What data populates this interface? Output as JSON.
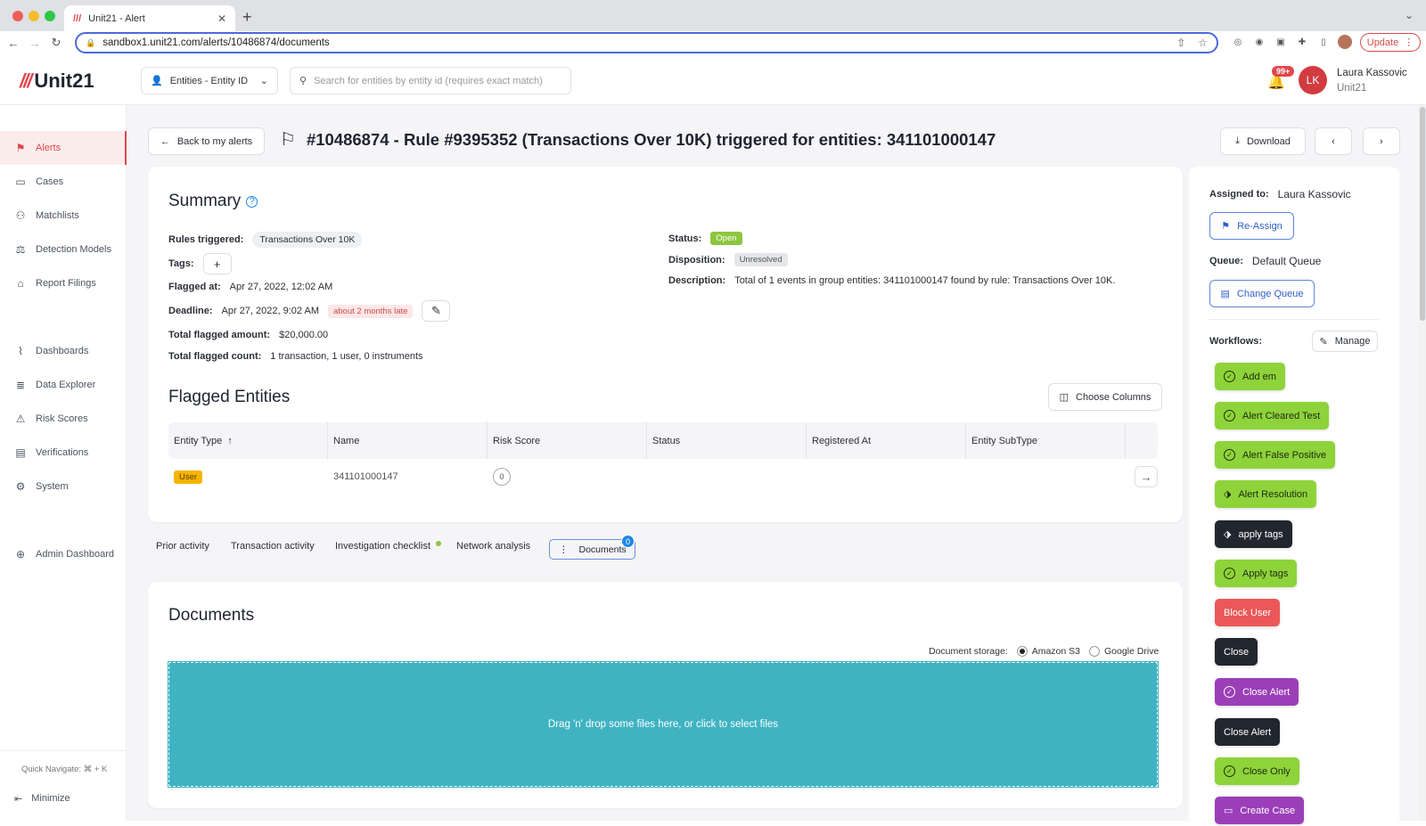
{
  "browser": {
    "tab_title": "Unit21 - Alert",
    "url": "sandbox1.unit21.com/alerts/10486874/documents",
    "update_label": "Update"
  },
  "header": {
    "logo_text": "Unit21",
    "entity_select": "Entities - Entity ID",
    "search_placeholder": "Search for entities by entity id (requires exact match)",
    "notif_count": "99+",
    "avatar_initials": "LK",
    "user_name": "Laura Kassovic",
    "user_org": "Unit21"
  },
  "sidebar": {
    "items": [
      {
        "label": "Alerts",
        "icon": "flag-icon"
      },
      {
        "label": "Cases",
        "icon": "briefcase-icon"
      },
      {
        "label": "Matchlists",
        "icon": "person-x-icon"
      },
      {
        "label": "Detection Models",
        "icon": "scale-icon"
      },
      {
        "label": "Report Filings",
        "icon": "bank-icon"
      },
      {
        "label": "Dashboards",
        "icon": "chart-icon"
      },
      {
        "label": "Data Explorer",
        "icon": "search-list-icon"
      },
      {
        "label": "Risk Scores",
        "icon": "warning-icon"
      },
      {
        "label": "Verifications",
        "icon": "id-card-icon"
      },
      {
        "label": "System",
        "icon": "gear-icon"
      },
      {
        "label": "Admin Dashboard",
        "icon": "globe-icon"
      }
    ],
    "quick_navigate": "Quick Navigate: ⌘ + K",
    "minimize": "Minimize"
  },
  "page": {
    "back_label": "Back to my alerts",
    "title": "#10486874 - Rule #9395352 (Transactions Over 10K) triggered for entities: 341101000147",
    "download_label": "Download"
  },
  "summary": {
    "heading": "Summary",
    "rules_triggered_label": "Rules triggered:",
    "rules_triggered_value": "Transactions Over 10K",
    "tags_label": "Tags:",
    "flagged_at_label": "Flagged at:",
    "flagged_at_value": "Apr 27, 2022, 12:02 AM",
    "deadline_label": "Deadline:",
    "deadline_value": "Apr 27, 2022, 9:02 AM",
    "deadline_badge": "about 2 months late",
    "amount_label": "Total flagged amount:",
    "amount_value": "$20,000.00",
    "count_label": "Total flagged count:",
    "count_value": "1 transaction, 1 user, 0 instruments",
    "status_label": "Status:",
    "status_value": "Open",
    "disposition_label": "Disposition:",
    "disposition_value": "Unresolved",
    "description_label": "Description:",
    "description_value": "Total of 1 events in group entities: 341101000147 found by rule: Transactions Over 10K."
  },
  "flagged": {
    "heading": "Flagged Entities",
    "choose_columns": "Choose Columns",
    "columns": [
      "Entity Type",
      "Name",
      "Risk Score",
      "Status",
      "Registered At",
      "Entity SubType"
    ],
    "rows": [
      {
        "type": "User",
        "name": "341101000147",
        "risk": "0",
        "status": "",
        "registered": "",
        "subtype": ""
      }
    ]
  },
  "tabs": {
    "items": [
      "Prior activity",
      "Transaction activity",
      "Investigation checklist",
      "Network analysis"
    ],
    "documents": "Documents",
    "documents_count": "0"
  },
  "documents": {
    "heading": "Documents",
    "storage_label": "Document storage:",
    "storage_options": [
      "Amazon S3",
      "Google Drive"
    ],
    "storage_selected": "Amazon S3",
    "drop_text": "Drag 'n' drop some files here, or click to select files"
  },
  "side": {
    "assigned_label": "Assigned to:",
    "assigned_value": "Laura Kassovic",
    "reassign": "Re-Assign",
    "queue_label": "Queue:",
    "queue_value": "Default Queue",
    "change_queue": "Change Queue",
    "workflows_label": "Workflows:",
    "manage": "Manage",
    "workflows": [
      {
        "label": "Add em",
        "style": "green",
        "icon": "check-circle-icon"
      },
      {
        "label": "Alert Cleared Test",
        "style": "green",
        "icon": "check-circle-icon"
      },
      {
        "label": "Alert False Positive",
        "style": "green",
        "icon": "check-circle-icon"
      },
      {
        "label": "Alert Resolution",
        "style": "green",
        "icon": "tag-icon"
      },
      {
        "label": "apply tags",
        "style": "dark",
        "icon": "tag-icon"
      },
      {
        "label": "Apply tags",
        "style": "green",
        "icon": "check-circle-icon"
      },
      {
        "label": "Block User",
        "style": "red",
        "icon": ""
      },
      {
        "label": "Close",
        "style": "dark",
        "icon": ""
      },
      {
        "label": "Close Alert",
        "style": "purple",
        "icon": "check-circle-icon"
      },
      {
        "label": "Close Alert",
        "style": "dark",
        "icon": ""
      },
      {
        "label": "Close Only",
        "style": "green",
        "icon": "check-circle-icon"
      },
      {
        "label": "Create Case",
        "style": "purple",
        "icon": "briefcase-icon"
      }
    ]
  },
  "colors": {
    "brand": "#e0474c",
    "green": "#8ed33a",
    "purple": "#9b3fb8",
    "dark": "#22262e",
    "dropzone": "#3fb3c2"
  }
}
